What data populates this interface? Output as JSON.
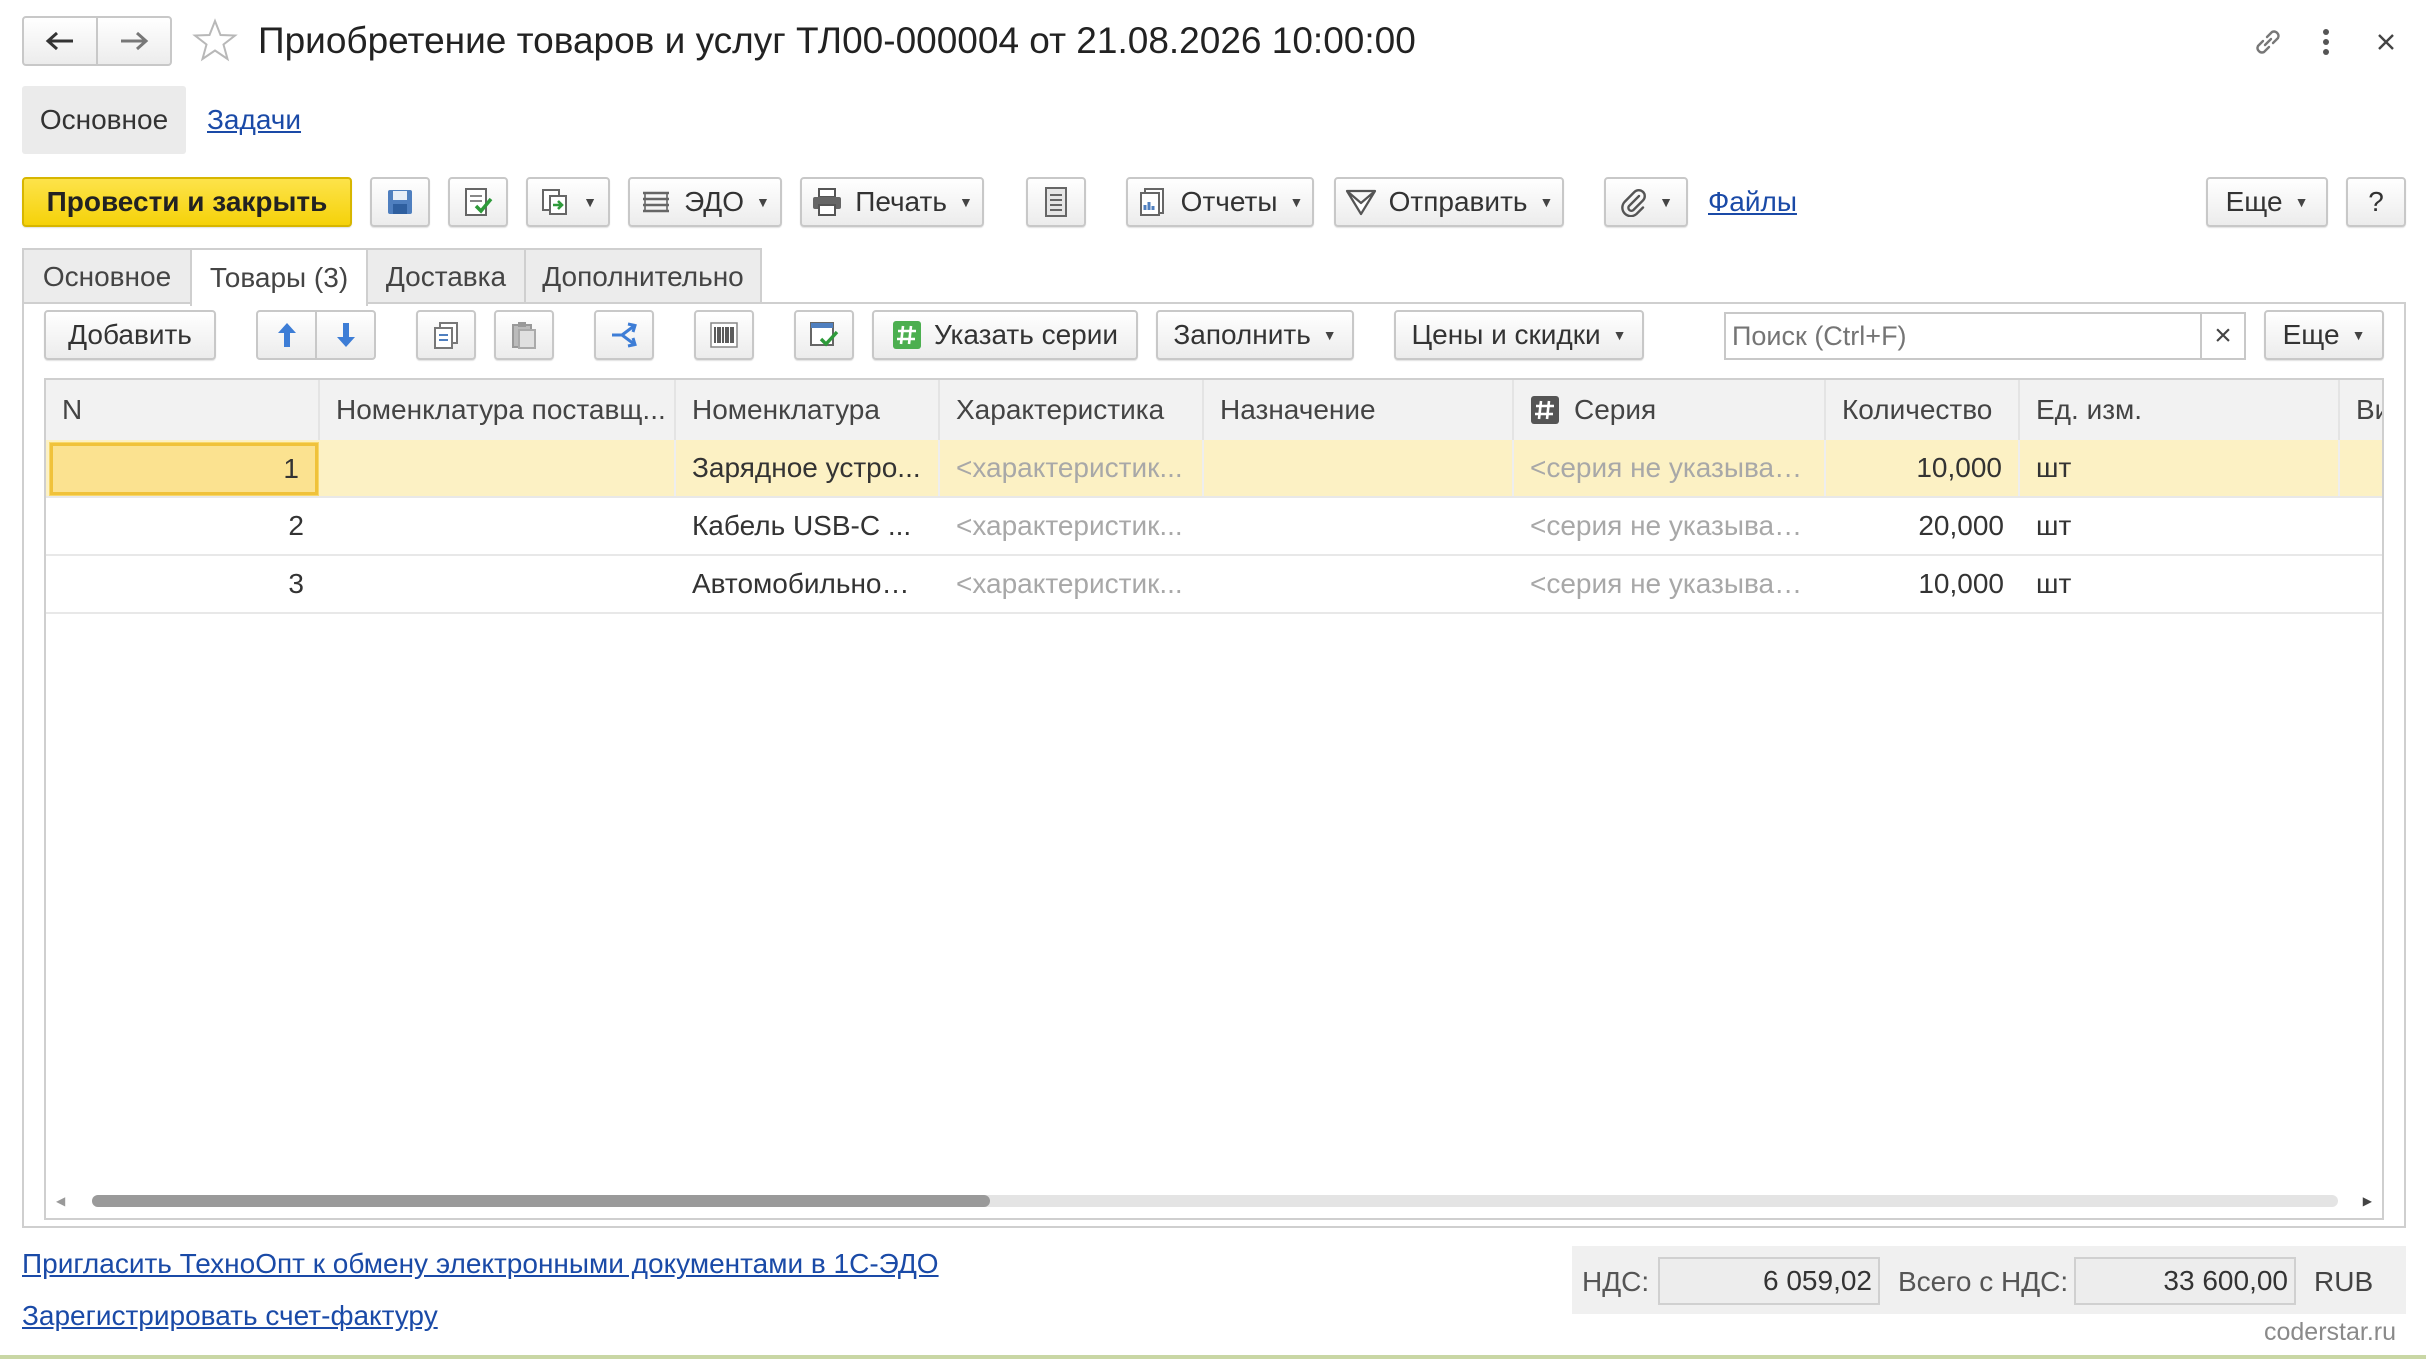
{
  "window": {
    "title": "Приобретение товаров и услуг ТЛ00-000004 от 21.08.2026 10:00:00",
    "back_icon": "arrow-left-icon",
    "forward_icon": "arrow-right-icon",
    "favorite_icon": "star-icon",
    "link_icon": "link-icon",
    "menu_icon": "more-vertical-icon",
    "close_icon": "close-icon"
  },
  "nav": {
    "main_label": "Основное",
    "tasks_label": "Задачи"
  },
  "toolbar": {
    "post_close_label": "Провести и закрыть",
    "edo_label": "ЭДО",
    "print_label": "Печать",
    "reports_label": "Отчеты",
    "send_label": "Отправить",
    "files_label": "Файлы",
    "more_label": "Еще",
    "help_label": "?"
  },
  "tabs": [
    {
      "label": "Основное",
      "active": false
    },
    {
      "label": "Товары (3)",
      "active": true
    },
    {
      "label": "Доставка",
      "active": false
    },
    {
      "label": "Дополнительно",
      "active": false
    }
  ],
  "table_toolbar": {
    "add_label": "Добавить",
    "series_label": "Указать серии",
    "fill_label": "Заполнить",
    "prices_label": "Цены и скидки",
    "search_placeholder": "Поиск (Ctrl+F)",
    "clear_label": "×",
    "more_label": "Еще"
  },
  "table": {
    "columns": [
      "N",
      "Номенклатура поставщ...",
      "Номенклатура",
      "Характеристика",
      "Назначение",
      "Серия",
      "Количество",
      "Ед. изм.",
      "Ви"
    ],
    "rows": [
      {
        "n": "1",
        "supplier_item": "",
        "item": "Зарядное устро...",
        "characteristic": "<характеристик...",
        "purpose": "",
        "series": "<серия не указывае...",
        "qty": "10,000",
        "unit": "шт",
        "selected": true
      },
      {
        "n": "2",
        "supplier_item": "",
        "item": "Кабель USB-C ...",
        "characteristic": "<характеристик...",
        "purpose": "",
        "series": "<серия не указывае...",
        "qty": "20,000",
        "unit": "шт",
        "selected": false
      },
      {
        "n": "3",
        "supplier_item": "",
        "item": "Автомобильное ...",
        "characteristic": "<характеристик...",
        "purpose": "",
        "series": "<серия не указывае...",
        "qty": "10,000",
        "unit": "шт",
        "selected": false
      }
    ]
  },
  "footer": {
    "invite_link": "Пригласить ТехноОпт к обмену электронными документами в 1С-ЭДО",
    "register_link": "Зарегистрировать счет-фактуру",
    "vat_label": "НДС:",
    "vat_value": "6 059,02",
    "total_label": "Всего с НДС:",
    "total_value": "33 600,00",
    "currency": "RUB",
    "watermark": "coderstar.ru"
  },
  "colors": {
    "primary_button": "#fbdc2f",
    "selected_row": "#fcf1c4",
    "selected_cell": "#fbe290",
    "link": "#1a4aa7"
  }
}
